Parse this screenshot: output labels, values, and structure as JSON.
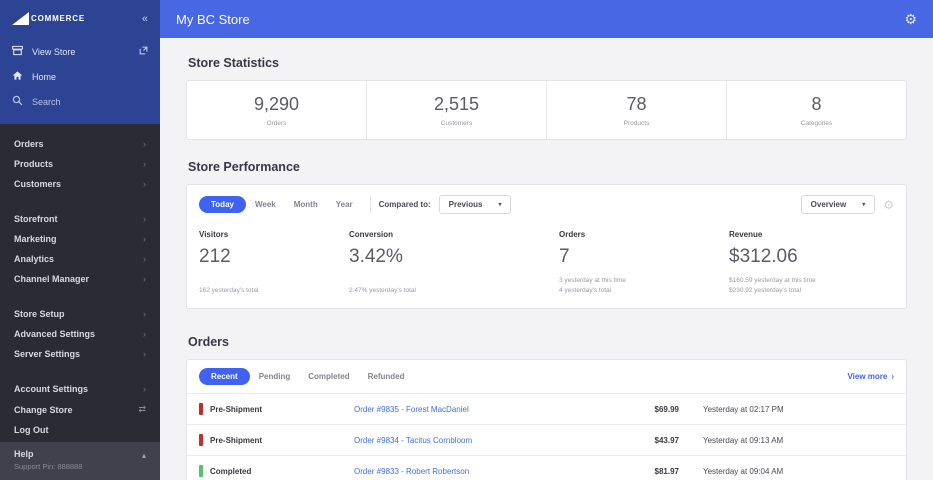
{
  "icons": {
    "collapse": "«",
    "chevron_right": "›",
    "caret_down": "▾",
    "caret_up": "▴",
    "gear": "⚙",
    "swap": "⇄"
  },
  "sidebar": {
    "logo_text": "COMMERCE",
    "top_items": [
      {
        "label": "View Store"
      },
      {
        "label": "Home"
      },
      {
        "label": "Search"
      }
    ],
    "menu": [
      {
        "label": "Orders"
      },
      {
        "label": "Products"
      },
      {
        "label": "Customers"
      },
      {
        "label": "Storefront"
      },
      {
        "label": "Marketing"
      },
      {
        "label": "Analytics"
      },
      {
        "label": "Channel Manager"
      },
      {
        "label": "Store Setup"
      },
      {
        "label": "Advanced Settings"
      },
      {
        "label": "Server Settings"
      },
      {
        "label": "Account Settings"
      },
      {
        "label": "Change Store"
      },
      {
        "label": "Log Out"
      }
    ],
    "help": {
      "label": "Help",
      "support_pin": "Support Pin: 888888"
    }
  },
  "header": {
    "title": "My BC Store"
  },
  "store_statistics": {
    "title": "Store Statistics",
    "stats": [
      {
        "value": "9,290",
        "label": "Orders"
      },
      {
        "value": "2,515",
        "label": "Customers"
      },
      {
        "value": "78",
        "label": "Products"
      },
      {
        "value": "8",
        "label": "Categories"
      }
    ]
  },
  "store_performance": {
    "title": "Store Performance",
    "period_tabs": [
      "Today",
      "Week",
      "Month",
      "Year"
    ],
    "active_tab": "Today",
    "compared_label": "Compared to:",
    "compared_value": "Previous",
    "view_value": "Overview",
    "metrics": [
      {
        "label": "Visitors",
        "value": "212",
        "sub1": "",
        "sub2": "162 yesterday's total"
      },
      {
        "label": "Conversion",
        "value": "3.42%",
        "sub1": "",
        "sub2": "2.47% yesterday's total"
      },
      {
        "label": "Orders",
        "value": "7",
        "sub1": "3 yesterday at this time",
        "sub2": "4 yesterday's total"
      },
      {
        "label": "Revenue",
        "value": "$312.06",
        "sub1": "$160.59 yesterday at this time",
        "sub2": "$230.92 yesterday's total"
      }
    ]
  },
  "orders_section": {
    "title": "Orders",
    "tabs": [
      "Recent",
      "Pending",
      "Completed",
      "Refunded"
    ],
    "active_tab": "Recent",
    "view_more": "View more",
    "rows": [
      {
        "status": "Pre-Shipment",
        "status_color": "#b8312f",
        "order": "Order #9835 - Forest MacDaniel",
        "amount": "$69.99",
        "time": "Yesterday at 02:17 PM"
      },
      {
        "status": "Pre-Shipment",
        "status_color": "#b8312f",
        "order": "Order #9834 - Tacitus Cornbloom",
        "amount": "$43.97",
        "time": "Yesterday at 09:13 AM"
      },
      {
        "status": "Completed",
        "status_color": "#56c271",
        "order": "Order #9833 - Robert Robertson",
        "amount": "$81.97",
        "time": "Yesterday at 09:04 AM"
      }
    ]
  },
  "colors": {
    "header_blue": "#4767e3",
    "sidebar_top_blue": "#2d4393",
    "sidebar_dark": "#2b2b36",
    "accent_blue": "#3f63f0",
    "link_blue": "#4070d8",
    "status_red": "#b8312f",
    "status_green": "#56c271"
  }
}
